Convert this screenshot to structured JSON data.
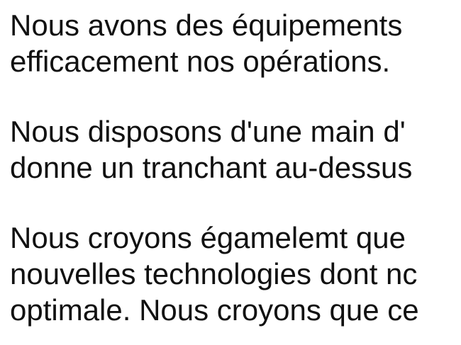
{
  "document": {
    "paragraphs": [
      {
        "lines": [
          "Nous avons des équipements",
          "efficacement nos opérations."
        ]
      },
      {
        "lines": [
          "Nous disposons d'une main d'",
          "donne un tranchant au-dessus"
        ]
      },
      {
        "lines": [
          "Nous croyons égamelemt que",
          "nouvelles technologies dont nc",
          "optimale. Nous croyons que ce"
        ]
      }
    ]
  }
}
